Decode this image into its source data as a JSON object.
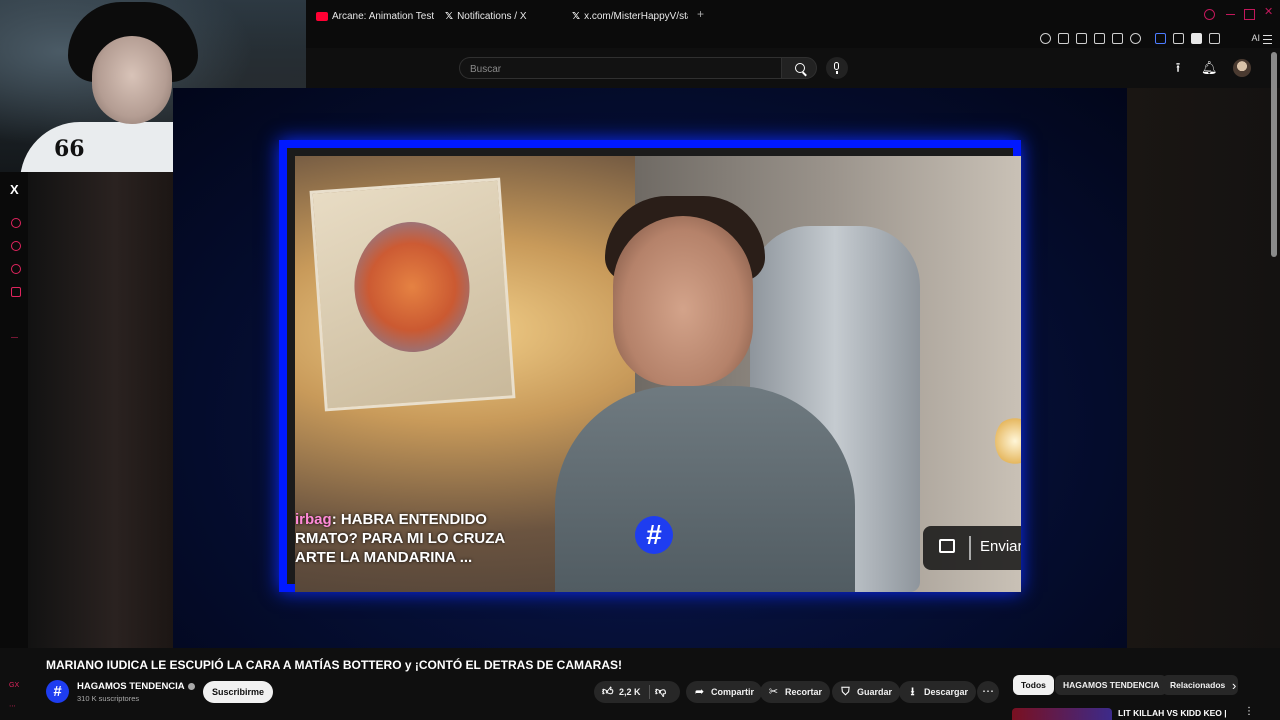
{
  "browser": {
    "tabs": [
      {
        "title": "Arcane: Animation Test -",
        "icon": "youtube-favicon"
      },
      {
        "title": "Notifications / X",
        "icon": "x-favicon"
      },
      {
        "title": "x.com/MisterHappyV/statu",
        "icon": "x-favicon"
      }
    ],
    "new_tab_label": "+",
    "ai_label": "AI",
    "accent_color": "#c2185b"
  },
  "youtube": {
    "search_placeholder": "Buscar",
    "video": {
      "title": "MARIANO IUDICA LE ESCUPIÓ LA CARA A MATÍAS BOTTERO y ¡CONTÓ EL DETRAS DE CAMARAS!",
      "chat_overlay": {
        "user": "irbag",
        "lines": [
          ": HABRA ENTENDIDO",
          "RMATO? PARA MI LO CRUZA",
          "ARTE LA MANDARINA ..."
        ]
      },
      "channel_logo_glyph": "#",
      "send_label": "Enviar",
      "frame_color": "#0019ff"
    },
    "channel": {
      "name": "HAGAMOS TENDENCIA",
      "subscribers": "310 K suscriptores",
      "subscribe_label": "Suscribirme",
      "avatar_glyph": "#"
    },
    "actions": {
      "likes": "2,2 K",
      "share": "Compartir",
      "clip": "Recortar",
      "save": "Guardar",
      "download": "Descargar",
      "more": "⋯"
    },
    "chips": [
      "Todos",
      "HAGAMOS TENDENCIA",
      "Relacionados"
    ],
    "related": {
      "first_title": "LIT KILLAH VS KIDD KEO |"
    }
  },
  "side_panel": {
    "x_label": "X",
    "bottom_labels": [
      "GX",
      "⋯"
    ]
  }
}
